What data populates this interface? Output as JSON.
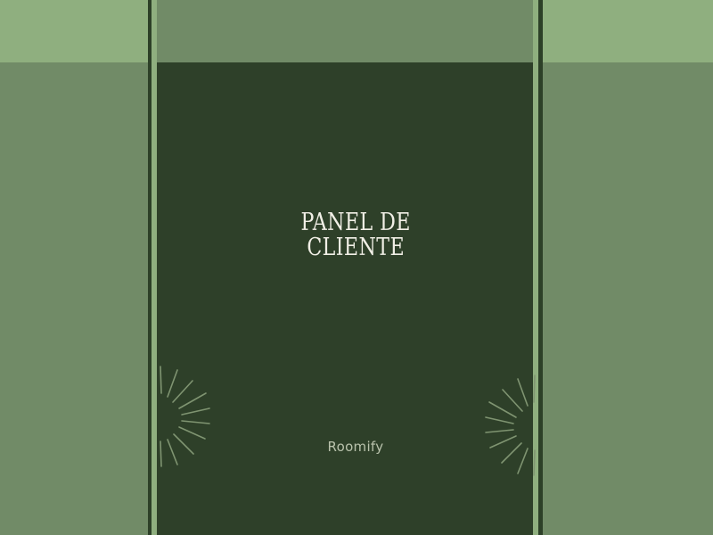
{
  "page": {
    "title_line1": "PANEL DE",
    "title_line2": "CLIENTE",
    "brand": "Roomify"
  },
  "colors": {
    "panel": "#2e4029",
    "side": "#718b67",
    "band": "#8faf7f",
    "title_text": "#f1efe6",
    "brand_text": "#b9c2ac",
    "burst": "#7f9471"
  },
  "icons": {
    "left_decoration": "sunburst-icon",
    "right_decoration": "sunburst-icon"
  }
}
